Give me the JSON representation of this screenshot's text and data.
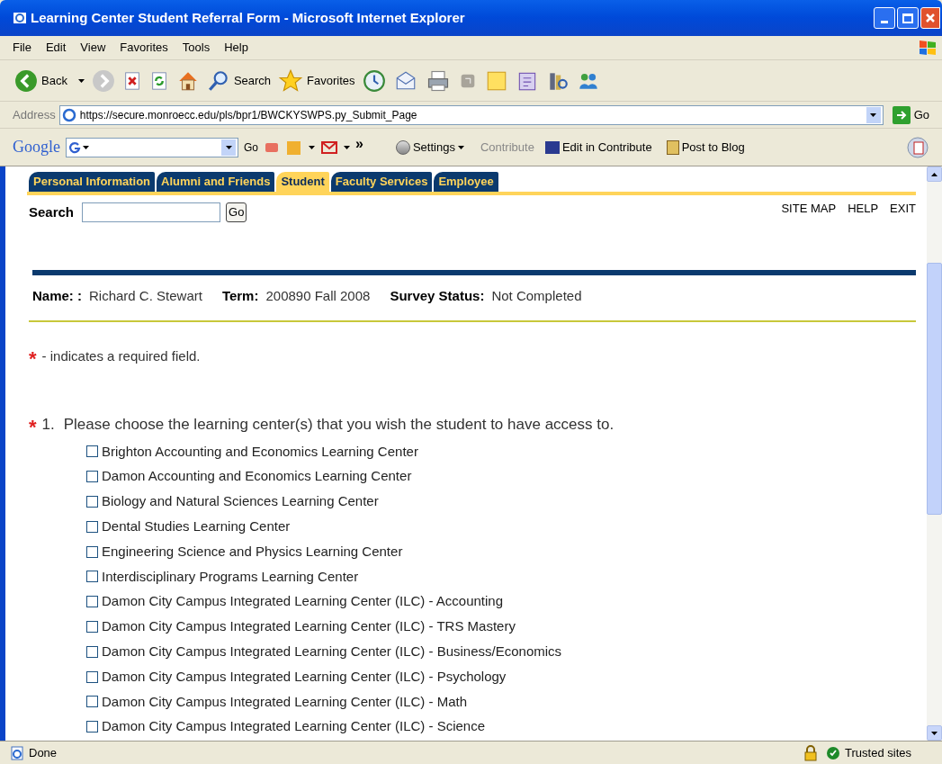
{
  "window": {
    "title": "Learning Center Student Referral Form - Microsoft Internet Explorer"
  },
  "menu": [
    "File",
    "Edit",
    "View",
    "Favorites",
    "Tools",
    "Help"
  ],
  "toolbar": [
    {
      "kind": "back",
      "label": "Back"
    },
    {
      "kind": "forward"
    },
    {
      "kind": "stop"
    },
    {
      "kind": "refresh"
    },
    {
      "kind": "home"
    },
    {
      "kind": "search",
      "label": "Search"
    },
    {
      "kind": "favorites",
      "label": "Favorites"
    },
    {
      "kind": "history"
    },
    {
      "kind": "mail"
    },
    {
      "kind": "print"
    },
    {
      "kind": "edit"
    },
    {
      "kind": "note"
    },
    {
      "kind": "messenger"
    },
    {
      "kind": "research"
    },
    {
      "kind": "people"
    }
  ],
  "address": {
    "label": "Address",
    "url": "https://secure.monroecc.edu/pls/bpr1/BWCKYSWPS.py_Submit_Page",
    "go": "Go"
  },
  "google_bar": {
    "logo": "Google",
    "go": "Go",
    "more": "»",
    "settings": "Settings",
    "contribute": "Contribute",
    "edit_in_contribute": "Edit in Contribute",
    "post_to_blog": "Post to Blog"
  },
  "tabs": [
    {
      "label": "Personal Information",
      "selected": false
    },
    {
      "label": "Alumni and Friends",
      "selected": false
    },
    {
      "label": "Student",
      "selected": true
    },
    {
      "label": "Faculty Services",
      "selected": false
    },
    {
      "label": "Employee",
      "selected": false
    }
  ],
  "search": {
    "label": "Search",
    "button": "Go"
  },
  "top_links": [
    "SITE MAP",
    "HELP",
    "EXIT"
  ],
  "info": [
    {
      "label": "Name: :",
      "value": "Richard C. Stewart"
    },
    {
      "label": "Term:",
      "value": "200890 Fall 2008"
    },
    {
      "label": "Survey Status:",
      "value": "Not Completed"
    }
  ],
  "required_note": {
    "mark": "*",
    "text": "- indicates a required field."
  },
  "question": {
    "mark": "*",
    "number": "1.",
    "text": "Please choose the learning center(s) that you wish the student to have access to.",
    "options": [
      {
        "label": "Brighton Accounting and Economics Learning Center",
        "checked": false
      },
      {
        "label": "Damon Accounting and Economics Learning Center",
        "checked": false
      },
      {
        "label": "Biology and Natural Sciences Learning Center",
        "checked": false
      },
      {
        "label": "Dental Studies Learning Center",
        "checked": false
      },
      {
        "label": "Engineering Science and Physics Learning Center",
        "checked": false
      },
      {
        "label": "Interdisciplinary Programs Learning Center",
        "checked": false
      },
      {
        "label": "Damon City Campus Integrated Learning Center (ILC) - Accounting",
        "checked": false
      },
      {
        "label": "Damon City Campus Integrated Learning Center (ILC) - TRS Mastery",
        "checked": false
      },
      {
        "label": "Damon City Campus Integrated Learning Center (ILC) - Business/Economics",
        "checked": false
      },
      {
        "label": "Damon City Campus Integrated Learning Center (ILC) - Psychology",
        "checked": false
      },
      {
        "label": "Damon City Campus Integrated Learning Center (ILC) - Math",
        "checked": false
      },
      {
        "label": "Damon City Campus Integrated Learning Center (ILC) - Science",
        "checked": false
      }
    ]
  },
  "status_bar": {
    "text": "Done",
    "zone": "Trusted sites"
  }
}
